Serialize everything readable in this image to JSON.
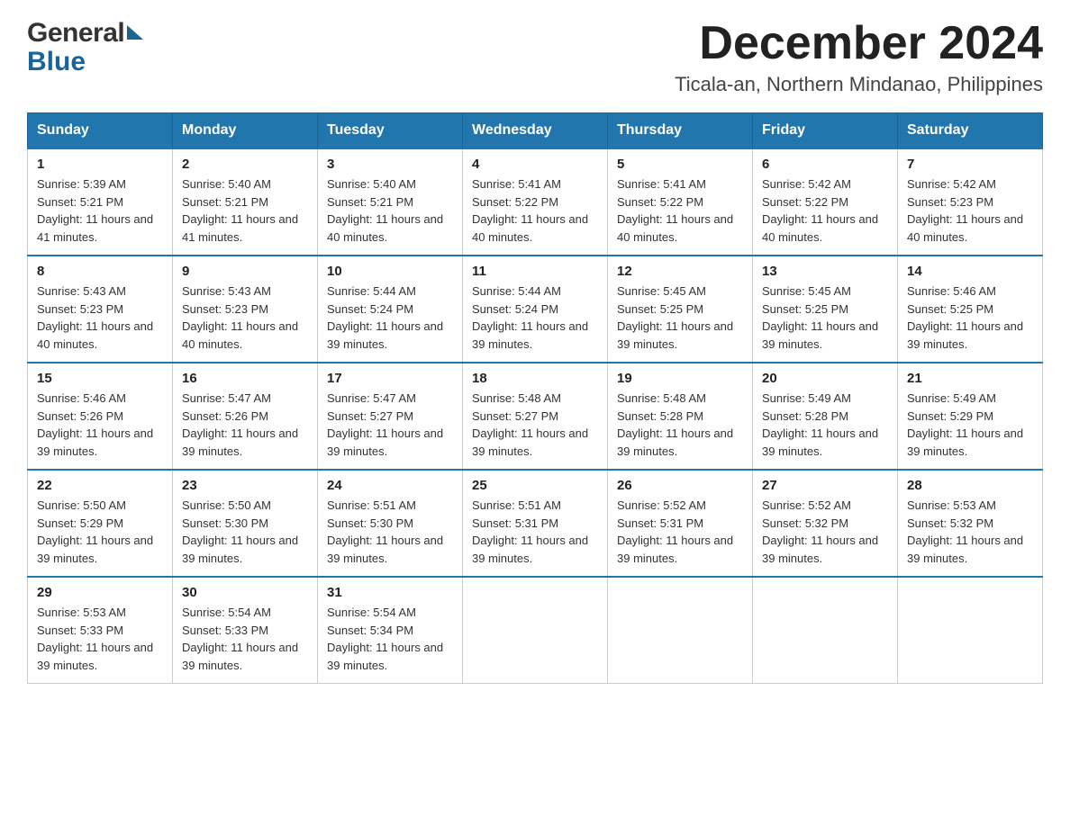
{
  "header": {
    "month_title": "December 2024",
    "location": "Ticala-an, Northern Mindanao, Philippines",
    "logo_general": "General",
    "logo_blue": "Blue"
  },
  "weekdays": [
    "Sunday",
    "Monday",
    "Tuesday",
    "Wednesday",
    "Thursday",
    "Friday",
    "Saturday"
  ],
  "weeks": [
    [
      {
        "day": "1",
        "sunrise": "5:39 AM",
        "sunset": "5:21 PM",
        "daylight": "11 hours and 41 minutes."
      },
      {
        "day": "2",
        "sunrise": "5:40 AM",
        "sunset": "5:21 PM",
        "daylight": "11 hours and 41 minutes."
      },
      {
        "day": "3",
        "sunrise": "5:40 AM",
        "sunset": "5:21 PM",
        "daylight": "11 hours and 40 minutes."
      },
      {
        "day": "4",
        "sunrise": "5:41 AM",
        "sunset": "5:22 PM",
        "daylight": "11 hours and 40 minutes."
      },
      {
        "day": "5",
        "sunrise": "5:41 AM",
        "sunset": "5:22 PM",
        "daylight": "11 hours and 40 minutes."
      },
      {
        "day": "6",
        "sunrise": "5:42 AM",
        "sunset": "5:22 PM",
        "daylight": "11 hours and 40 minutes."
      },
      {
        "day": "7",
        "sunrise": "5:42 AM",
        "sunset": "5:23 PM",
        "daylight": "11 hours and 40 minutes."
      }
    ],
    [
      {
        "day": "8",
        "sunrise": "5:43 AM",
        "sunset": "5:23 PM",
        "daylight": "11 hours and 40 minutes."
      },
      {
        "day": "9",
        "sunrise": "5:43 AM",
        "sunset": "5:23 PM",
        "daylight": "11 hours and 40 minutes."
      },
      {
        "day": "10",
        "sunrise": "5:44 AM",
        "sunset": "5:24 PM",
        "daylight": "11 hours and 39 minutes."
      },
      {
        "day": "11",
        "sunrise": "5:44 AM",
        "sunset": "5:24 PM",
        "daylight": "11 hours and 39 minutes."
      },
      {
        "day": "12",
        "sunrise": "5:45 AM",
        "sunset": "5:25 PM",
        "daylight": "11 hours and 39 minutes."
      },
      {
        "day": "13",
        "sunrise": "5:45 AM",
        "sunset": "5:25 PM",
        "daylight": "11 hours and 39 minutes."
      },
      {
        "day": "14",
        "sunrise": "5:46 AM",
        "sunset": "5:25 PM",
        "daylight": "11 hours and 39 minutes."
      }
    ],
    [
      {
        "day": "15",
        "sunrise": "5:46 AM",
        "sunset": "5:26 PM",
        "daylight": "11 hours and 39 minutes."
      },
      {
        "day": "16",
        "sunrise": "5:47 AM",
        "sunset": "5:26 PM",
        "daylight": "11 hours and 39 minutes."
      },
      {
        "day": "17",
        "sunrise": "5:47 AM",
        "sunset": "5:27 PM",
        "daylight": "11 hours and 39 minutes."
      },
      {
        "day": "18",
        "sunrise": "5:48 AM",
        "sunset": "5:27 PM",
        "daylight": "11 hours and 39 minutes."
      },
      {
        "day": "19",
        "sunrise": "5:48 AM",
        "sunset": "5:28 PM",
        "daylight": "11 hours and 39 minutes."
      },
      {
        "day": "20",
        "sunrise": "5:49 AM",
        "sunset": "5:28 PM",
        "daylight": "11 hours and 39 minutes."
      },
      {
        "day": "21",
        "sunrise": "5:49 AM",
        "sunset": "5:29 PM",
        "daylight": "11 hours and 39 minutes."
      }
    ],
    [
      {
        "day": "22",
        "sunrise": "5:50 AM",
        "sunset": "5:29 PM",
        "daylight": "11 hours and 39 minutes."
      },
      {
        "day": "23",
        "sunrise": "5:50 AM",
        "sunset": "5:30 PM",
        "daylight": "11 hours and 39 minutes."
      },
      {
        "day": "24",
        "sunrise": "5:51 AM",
        "sunset": "5:30 PM",
        "daylight": "11 hours and 39 minutes."
      },
      {
        "day": "25",
        "sunrise": "5:51 AM",
        "sunset": "5:31 PM",
        "daylight": "11 hours and 39 minutes."
      },
      {
        "day": "26",
        "sunrise": "5:52 AM",
        "sunset": "5:31 PM",
        "daylight": "11 hours and 39 minutes."
      },
      {
        "day": "27",
        "sunrise": "5:52 AM",
        "sunset": "5:32 PM",
        "daylight": "11 hours and 39 minutes."
      },
      {
        "day": "28",
        "sunrise": "5:53 AM",
        "sunset": "5:32 PM",
        "daylight": "11 hours and 39 minutes."
      }
    ],
    [
      {
        "day": "29",
        "sunrise": "5:53 AM",
        "sunset": "5:33 PM",
        "daylight": "11 hours and 39 minutes."
      },
      {
        "day": "30",
        "sunrise": "5:54 AM",
        "sunset": "5:33 PM",
        "daylight": "11 hours and 39 minutes."
      },
      {
        "day": "31",
        "sunrise": "5:54 AM",
        "sunset": "5:34 PM",
        "daylight": "11 hours and 39 minutes."
      },
      null,
      null,
      null,
      null
    ]
  ],
  "labels": {
    "sunrise": "Sunrise:",
    "sunset": "Sunset:",
    "daylight": "Daylight:"
  }
}
